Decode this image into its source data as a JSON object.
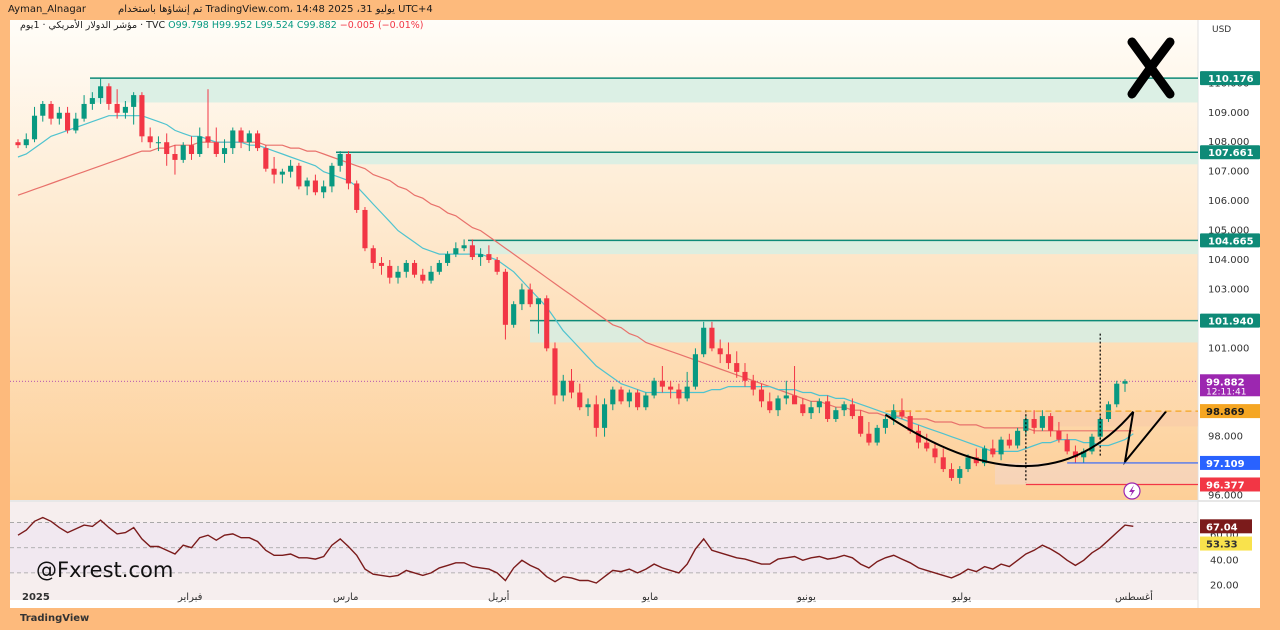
{
  "header": {
    "user": "Ayman_Alnagar",
    "published": "تم إنشاؤها باستخدام TradingView.com، يوليو 31، 2025 14:48 UTC+4"
  },
  "ticker_line": {
    "name": "مؤشر الدولار الأمريكي · 1يوم · TVC",
    "open": "O99.798",
    "high": "H99.952",
    "low": "L99.524",
    "close": "C99.882",
    "change": "−0.005 (−0.01%)"
  },
  "watermark": "@Fxrest.com",
  "footer_logo": "TradingView",
  "colors": {
    "up": "#089981",
    "down": "#f23645",
    "ma_fast": "#4fc3cf",
    "ma_slow": "#e8716b",
    "zone": "#d6eee4",
    "zone_line": "#0e8a77",
    "rsi_line": "#7b1b1b",
    "pattern": "#000000"
  },
  "chart_data": {
    "type": "candlestick",
    "currency": "USD",
    "y_ticks": [
      "110.000",
      "109.000",
      "108.000",
      "107.000",
      "106.000",
      "105.000",
      "104.000",
      "103.000",
      "101.000",
      "98.000",
      "96.000"
    ],
    "y_tick_values": [
      110,
      109,
      108,
      107,
      106,
      105,
      104,
      103,
      101,
      98,
      96
    ],
    "ylim": [
      95.85,
      111.2
    ],
    "x_labels": [
      "2025",
      "فبراير",
      "مارس",
      "أبريل",
      "مايو",
      "يونيو",
      "يوليو",
      "أغسطس"
    ],
    "zones": [
      {
        "top": 110.176,
        "bottom": 109.35,
        "label": "110.176"
      },
      {
        "top": 107.661,
        "bottom": 107.25,
        "label": "107.661"
      },
      {
        "top": 104.665,
        "bottom": 104.2,
        "label": "104.665"
      },
      {
        "top": 101.94,
        "bottom": 101.2,
        "label": "101.940"
      }
    ],
    "price_labels": [
      {
        "value": 99.882,
        "text": "99.882",
        "sub": "12:11:41",
        "kind": "current"
      },
      {
        "value": 98.869,
        "text": "98.869",
        "kind": "neckline"
      },
      {
        "value": 97.109,
        "text": "97.109",
        "kind": "support"
      },
      {
        "value": 96.377,
        "text": "96.377",
        "kind": "low"
      }
    ],
    "candles": [
      [
        108.0,
        108.1,
        107.8,
        107.9
      ],
      [
        107.9,
        108.3,
        107.8,
        108.1
      ],
      [
        108.1,
        109.2,
        108.0,
        108.9
      ],
      [
        108.9,
        109.4,
        108.7,
        109.3
      ],
      [
        109.3,
        109.4,
        108.6,
        108.8
      ],
      [
        108.8,
        109.2,
        108.6,
        109.0
      ],
      [
        109.0,
        109.2,
        108.3,
        108.4
      ],
      [
        108.4,
        109.0,
        108.3,
        108.8
      ],
      [
        108.8,
        109.6,
        108.7,
        109.3
      ],
      [
        109.3,
        109.7,
        109.1,
        109.5
      ],
      [
        109.5,
        110.2,
        109.3,
        109.9
      ],
      [
        109.9,
        110.0,
        109.1,
        109.3
      ],
      [
        109.3,
        109.8,
        108.8,
        109.0
      ],
      [
        109.0,
        109.4,
        108.8,
        109.2
      ],
      [
        109.2,
        109.7,
        108.6,
        109.6
      ],
      [
        109.6,
        109.7,
        108.0,
        108.2
      ],
      [
        108.2,
        108.5,
        107.8,
        108.0
      ],
      [
        108.0,
        108.2,
        107.7,
        108.0
      ],
      [
        108.0,
        108.3,
        107.2,
        107.6
      ],
      [
        107.6,
        107.9,
        106.9,
        107.4
      ],
      [
        107.4,
        108.0,
        107.3,
        107.9
      ],
      [
        107.9,
        108.2,
        107.4,
        107.6
      ],
      [
        107.6,
        108.5,
        107.5,
        108.2
      ],
      [
        108.2,
        109.8,
        107.8,
        108.0
      ],
      [
        108.0,
        108.5,
        107.5,
        107.6
      ],
      [
        107.6,
        108.1,
        107.3,
        107.8
      ],
      [
        107.8,
        108.5,
        107.6,
        108.4
      ],
      [
        108.4,
        108.5,
        107.8,
        108.0
      ],
      [
        108.0,
        108.4,
        107.7,
        108.3
      ],
      [
        108.3,
        108.4,
        107.7,
        107.8
      ],
      [
        107.8,
        107.9,
        107.0,
        107.1
      ],
      [
        107.1,
        107.5,
        106.6,
        106.9
      ],
      [
        106.9,
        107.1,
        106.6,
        107.0
      ],
      [
        107.0,
        107.4,
        106.8,
        107.2
      ],
      [
        107.2,
        107.3,
        106.4,
        106.5
      ],
      [
        106.5,
        106.8,
        106.2,
        106.7
      ],
      [
        106.7,
        106.9,
        106.2,
        106.3
      ],
      [
        106.3,
        106.7,
        106.1,
        106.5
      ],
      [
        106.5,
        107.3,
        106.3,
        107.2
      ],
      [
        107.2,
        107.7,
        107.0,
        107.6
      ],
      [
        107.6,
        107.7,
        106.4,
        106.6
      ],
      [
        106.6,
        106.7,
        105.6,
        105.7
      ],
      [
        105.7,
        105.8,
        104.3,
        104.4
      ],
      [
        104.4,
        104.5,
        103.7,
        103.9
      ],
      [
        103.9,
        104.1,
        103.5,
        103.8
      ],
      [
        103.8,
        104.0,
        103.2,
        103.4
      ],
      [
        103.4,
        103.8,
        103.2,
        103.6
      ],
      [
        103.6,
        104.0,
        103.4,
        103.9
      ],
      [
        103.9,
        104.0,
        103.4,
        103.5
      ],
      [
        103.5,
        103.7,
        103.2,
        103.3
      ],
      [
        103.3,
        103.8,
        103.2,
        103.6
      ],
      [
        103.6,
        104.0,
        103.5,
        103.9
      ],
      [
        103.9,
        104.3,
        103.8,
        104.2
      ],
      [
        104.2,
        104.6,
        104.1,
        104.4
      ],
      [
        104.4,
        104.7,
        104.3,
        104.5
      ],
      [
        104.5,
        104.7,
        104.0,
        104.1
      ],
      [
        104.1,
        104.4,
        103.8,
        104.2
      ],
      [
        104.2,
        104.5,
        103.9,
        104.0
      ],
      [
        104.0,
        104.1,
        103.5,
        103.6
      ],
      [
        103.6,
        103.7,
        101.3,
        101.8
      ],
      [
        101.8,
        102.6,
        101.7,
        102.5
      ],
      [
        102.5,
        103.2,
        102.3,
        103.0
      ],
      [
        103.0,
        103.2,
        102.4,
        102.5
      ],
      [
        102.5,
        102.6,
        101.5,
        102.7
      ],
      [
        102.7,
        102.8,
        100.9,
        101.0
      ],
      [
        101.0,
        101.2,
        99.1,
        99.4
      ],
      [
        99.4,
        100.1,
        99.2,
        99.9
      ],
      [
        99.9,
        100.3,
        99.3,
        99.5
      ],
      [
        99.5,
        99.8,
        98.9,
        99.0
      ],
      [
        99.0,
        99.3,
        98.7,
        99.1
      ],
      [
        99.1,
        99.4,
        98.0,
        98.3
      ],
      [
        98.3,
        99.3,
        98.0,
        99.1
      ],
      [
        99.1,
        99.7,
        98.9,
        99.6
      ],
      [
        99.6,
        99.7,
        99.1,
        99.2
      ],
      [
        99.2,
        99.6,
        99.0,
        99.5
      ],
      [
        99.5,
        99.6,
        98.9,
        99.0
      ],
      [
        99.0,
        99.5,
        98.9,
        99.4
      ],
      [
        99.4,
        100.0,
        99.3,
        99.9
      ],
      [
        99.9,
        100.4,
        99.5,
        99.7
      ],
      [
        99.7,
        99.9,
        99.3,
        99.6
      ],
      [
        99.6,
        99.8,
        99.1,
        99.3
      ],
      [
        99.3,
        100.2,
        99.2,
        99.7
      ],
      [
        99.7,
        101.0,
        99.6,
        100.8
      ],
      [
        100.8,
        101.9,
        100.7,
        101.7
      ],
      [
        101.7,
        101.9,
        100.9,
        101.0
      ],
      [
        101.0,
        101.3,
        100.5,
        100.8
      ],
      [
        100.8,
        101.2,
        100.3,
        100.5
      ],
      [
        100.5,
        100.9,
        100.0,
        100.2
      ],
      [
        100.2,
        100.5,
        99.7,
        99.9
      ],
      [
        99.9,
        100.1,
        99.4,
        99.6
      ],
      [
        99.6,
        99.8,
        99.0,
        99.2
      ],
      [
        99.2,
        99.5,
        98.8,
        98.9
      ],
      [
        98.9,
        99.4,
        98.7,
        99.3
      ],
      [
        99.3,
        99.9,
        99.1,
        99.4
      ],
      [
        99.4,
        100.4,
        99.2,
        99.1
      ],
      [
        99.1,
        99.3,
        98.7,
        98.8
      ],
      [
        98.8,
        99.2,
        98.6,
        99.0
      ],
      [
        99.0,
        99.3,
        98.8,
        99.2
      ],
      [
        99.2,
        99.4,
        98.5,
        98.6
      ],
      [
        98.6,
        99.0,
        98.5,
        98.9
      ],
      [
        98.9,
        99.2,
        98.7,
        99.1
      ],
      [
        99.1,
        99.3,
        98.6,
        98.7
      ],
      [
        98.7,
        98.9,
        98.0,
        98.1
      ],
      [
        98.1,
        98.5,
        97.7,
        97.8
      ],
      [
        97.8,
        98.4,
        97.7,
        98.3
      ],
      [
        98.3,
        98.7,
        98.1,
        98.6
      ],
      [
        98.6,
        99.1,
        98.4,
        98.9
      ],
      [
        98.9,
        99.3,
        98.6,
        98.7
      ],
      [
        98.7,
        98.9,
        98.1,
        98.2
      ],
      [
        98.2,
        98.4,
        97.6,
        97.8
      ],
      [
        97.8,
        98.1,
        97.5,
        97.6
      ],
      [
        97.6,
        97.8,
        97.1,
        97.3
      ],
      [
        97.3,
        97.6,
        96.8,
        96.9
      ],
      [
        96.9,
        97.1,
        96.5,
        96.6
      ],
      [
        96.6,
        97.0,
        96.4,
        96.9
      ],
      [
        96.9,
        97.4,
        96.8,
        97.3
      ],
      [
        97.3,
        97.6,
        97.0,
        97.1
      ],
      [
        97.1,
        97.7,
        97.0,
        97.6
      ],
      [
        97.6,
        97.9,
        97.3,
        97.4
      ],
      [
        97.4,
        98.0,
        97.2,
        97.9
      ],
      [
        97.9,
        98.1,
        97.6,
        97.7
      ],
      [
        97.7,
        98.3,
        97.6,
        98.2
      ],
      [
        98.2,
        98.7,
        98.0,
        98.6
      ],
      [
        98.6,
        98.9,
        98.1,
        98.3
      ],
      [
        98.3,
        98.9,
        98.2,
        98.7
      ],
      [
        98.7,
        98.8,
        98.0,
        98.2
      ],
      [
        98.2,
        98.5,
        97.8,
        97.9
      ],
      [
        97.9,
        98.1,
        97.4,
        97.5
      ],
      [
        97.5,
        97.7,
        97.1,
        97.3
      ],
      [
        97.3,
        97.6,
        97.1,
        97.5
      ],
      [
        97.5,
        98.1,
        97.4,
        98.0
      ],
      [
        98.0,
        98.7,
        97.9,
        98.6
      ],
      [
        98.6,
        99.2,
        98.5,
        99.1
      ],
      [
        99.1,
        99.9,
        99.0,
        99.8
      ],
      [
        99.8,
        99.95,
        99.52,
        99.882
      ]
    ],
    "ma_fast": [
      107.5,
      107.6,
      107.8,
      108.0,
      108.2,
      108.3,
      108.4,
      108.5,
      108.6,
      108.7,
      108.8,
      108.9,
      108.9,
      108.9,
      108.9,
      108.9,
      108.8,
      108.7,
      108.6,
      108.4,
      108.3,
      108.2,
      108.2,
      108.1,
      108.0,
      108.0,
      108.0,
      108.0,
      107.9,
      107.9,
      107.8,
      107.7,
      107.6,
      107.5,
      107.4,
      107.3,
      107.2,
      107.0,
      106.9,
      106.8,
      106.7,
      106.5,
      106.2,
      105.9,
      105.6,
      105.3,
      105.0,
      104.8,
      104.6,
      104.4,
      104.3,
      104.2,
      104.2,
      104.2,
      104.2,
      104.2,
      104.2,
      104.1,
      104.0,
      103.8,
      103.6,
      103.3,
      103.0,
      102.7,
      102.4,
      102.0,
      101.6,
      101.3,
      101.0,
      100.7,
      100.4,
      100.2,
      100.0,
      99.8,
      99.7,
      99.6,
      99.5,
      99.5,
      99.5,
      99.5,
      99.5,
      99.5,
      99.5,
      99.5,
      99.6,
      99.6,
      99.7,
      99.7,
      99.7,
      99.7,
      99.7,
      99.7,
      99.6,
      99.6,
      99.6,
      99.5,
      99.5,
      99.4,
      99.4,
      99.3,
      99.3,
      99.2,
      99.1,
      99.0,
      98.9,
      98.8,
      98.7,
      98.6,
      98.5,
      98.4,
      98.3,
      98.2,
      98.1,
      98.0,
      97.9,
      97.8,
      97.7,
      97.6,
      97.5,
      97.5,
      97.5,
      97.5,
      97.6,
      97.7,
      97.8,
      97.8,
      97.9,
      97.9,
      97.9,
      97.8,
      97.8,
      97.7,
      97.7,
      97.8,
      97.9,
      98.1
    ],
    "ma_slow": [
      106.2,
      106.3,
      106.4,
      106.5,
      106.6,
      106.7,
      106.8,
      106.9,
      107.0,
      107.1,
      107.2,
      107.3,
      107.4,
      107.5,
      107.6,
      107.7,
      107.7,
      107.8,
      107.8,
      107.9,
      107.9,
      107.9,
      108.0,
      108.0,
      108.0,
      108.0,
      108.0,
      108.0,
      108.0,
      108.0,
      107.9,
      107.9,
      107.9,
      107.8,
      107.8,
      107.7,
      107.7,
      107.6,
      107.5,
      107.4,
      107.3,
      107.2,
      107.1,
      106.9,
      106.8,
      106.7,
      106.5,
      106.4,
      106.2,
      106.1,
      105.9,
      105.8,
      105.6,
      105.5,
      105.3,
      105.1,
      105.0,
      104.8,
      104.6,
      104.4,
      104.2,
      104.0,
      103.8,
      103.6,
      103.4,
      103.2,
      103.0,
      102.8,
      102.6,
      102.4,
      102.2,
      102.0,
      101.8,
      101.7,
      101.5,
      101.4,
      101.2,
      101.1,
      101.0,
      100.9,
      100.8,
      100.7,
      100.6,
      100.5,
      100.4,
      100.3,
      100.2,
      100.1,
      100.0,
      99.9,
      99.8,
      99.7,
      99.6,
      99.5,
      99.4,
      99.3,
      99.2,
      99.2,
      99.1,
      99.0,
      99.0,
      98.9,
      98.9,
      98.8,
      98.8,
      98.7,
      98.7,
      98.7,
      98.6,
      98.6,
      98.6,
      98.5,
      98.5,
      98.5,
      98.4,
      98.4,
      98.4,
      98.3,
      98.3,
      98.3,
      98.3,
      98.3,
      98.3,
      98.2,
      98.2,
      98.2,
      98.2,
      98.2,
      98.2,
      98.2,
      98.2,
      98.2,
      98.2,
      98.2,
      98.2,
      98.2
    ],
    "rsi": {
      "ticks": [
        "60.00",
        "40.00",
        "20.00"
      ],
      "tick_values": [
        60,
        40,
        20
      ],
      "ylim": [
        18,
        80
      ],
      "value": "67.04",
      "ma_value": "53.33",
      "values": [
        60,
        64,
        71,
        74,
        71,
        66,
        62,
        65,
        68,
        67,
        72,
        66,
        61,
        62,
        66,
        57,
        51,
        51,
        48,
        45,
        52,
        50,
        58,
        60,
        56,
        60,
        61,
        58,
        58,
        55,
        48,
        44,
        44,
        45,
        42,
        42,
        41,
        43,
        52,
        57,
        51,
        44,
        33,
        29,
        28,
        27,
        28,
        32,
        30,
        28,
        30,
        34,
        36,
        38,
        38,
        35,
        34,
        33,
        30,
        24,
        34,
        40,
        36,
        33,
        27,
        23,
        27,
        26,
        24,
        24,
        22,
        27,
        32,
        31,
        33,
        30,
        33,
        37,
        34,
        32,
        30,
        37,
        49,
        57,
        48,
        46,
        44,
        42,
        41,
        39,
        37,
        37,
        41,
        42,
        43,
        40,
        42,
        43,
        41,
        42,
        44,
        42,
        37,
        34,
        39,
        42,
        44,
        41,
        38,
        34,
        32,
        30,
        28,
        26,
        29,
        33,
        31,
        35,
        33,
        37,
        35,
        40,
        45,
        48,
        52,
        49,
        45,
        40,
        36,
        40,
        46,
        50,
        56,
        62,
        68,
        67.04
      ]
    }
  }
}
